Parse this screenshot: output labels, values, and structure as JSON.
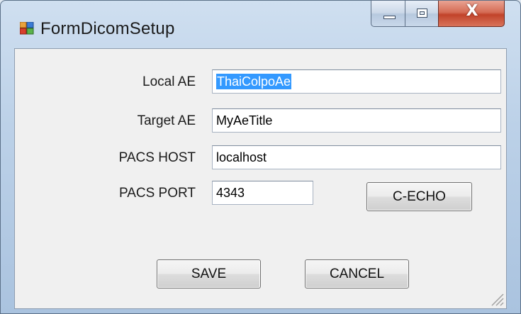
{
  "window": {
    "title": "FormDicomSetup",
    "controls": {
      "minimize_icon": "minimize-icon",
      "maximize_icon": "maximize-icon",
      "close_glyph": "X"
    }
  },
  "form": {
    "local_ae": {
      "label": "Local AE",
      "value": "ThaiColpoAe",
      "selected": true
    },
    "target_ae": {
      "label": "Target AE",
      "value": "MyAeTitle"
    },
    "pacs_host": {
      "label": "PACS HOST",
      "value": "localhost"
    },
    "pacs_port": {
      "label": "PACS PORT",
      "value": "4343"
    },
    "echo_button": "C-ECHO",
    "save_button": "SAVE",
    "cancel_button": "CANCEL"
  },
  "colors": {
    "selection": "#3399ff",
    "client_bg": "#f0f0f0",
    "close_red": "#c2432a"
  }
}
